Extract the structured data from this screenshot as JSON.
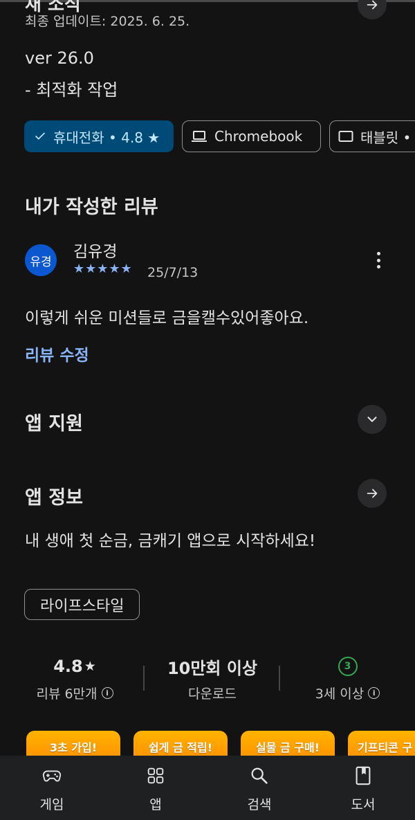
{
  "whats_new": {
    "heading_partial": "새 소식",
    "updated": "최종 업데이트: 2025. 6. 25.",
    "version": "ver 26.0",
    "notes": "- 최적화 작업"
  },
  "device_chips": [
    {
      "label": "휴대전화 • 4.8 ★",
      "selected": true
    },
    {
      "label": "Chromebook",
      "selected": false
    },
    {
      "label": "태블릿 •",
      "selected": false
    }
  ],
  "my_review": {
    "title": "내가 작성한 리뷰",
    "avatar_text": "유경",
    "reviewer": "김유경",
    "stars": "★★★★★",
    "rating": 5,
    "date": "25/7/13",
    "text": "이렇게 쉬운 미션들로 금을캘수있어좋아요.",
    "edit_label": "리뷰 수정"
  },
  "app_support": {
    "title": "앱 지원"
  },
  "app_info": {
    "title": "앱 정보",
    "description": "내 생애 첫 순금, 금캐기 앱으로 시작하세요!",
    "category": "라이프스타일"
  },
  "stats": {
    "rating_value": "4.8",
    "rating_star": "★",
    "rating_label": "리뷰 6만개",
    "downloads_value": "10만회 이상",
    "downloads_label": "다운로드",
    "age_badge": "3",
    "age_label": "3세 이상"
  },
  "promos": [
    "3초 가입!",
    "쉽게 금 적립!",
    "실물 금 구매!",
    "기프티콘 구"
  ],
  "bottom_nav": [
    {
      "label": "게임",
      "icon": "gamepad-icon"
    },
    {
      "label": "앱",
      "icon": "apps-grid-icon"
    },
    {
      "label": "검색",
      "icon": "search-icon"
    },
    {
      "label": "도서",
      "icon": "book-icon"
    }
  ],
  "colors": {
    "background": "#131314",
    "selected_chip": "#004a77",
    "link": "#8ab4f8",
    "avatar": "#0b57d0",
    "age_badge": "#34a853",
    "promo": "#ffa000"
  }
}
